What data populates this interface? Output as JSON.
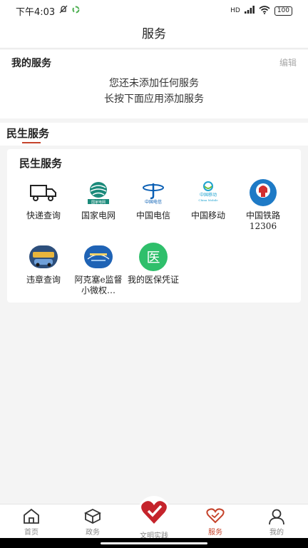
{
  "status_bar": {
    "time": "下午4:03",
    "signal": "HD",
    "battery": "100"
  },
  "nav": {
    "title": "服务"
  },
  "my_services": {
    "title": "我的服务",
    "edit": "编辑",
    "empty_line1": "您还未添加任何服务",
    "empty_line2": "长按下面应用添加服务"
  },
  "section_tab": {
    "label": "民生服务"
  },
  "card": {
    "title": "民生服务",
    "items": [
      {
        "label": "快递查询",
        "icon": "truck-icon"
      },
      {
        "label": "国家电网",
        "icon": "state-grid-icon"
      },
      {
        "label": "中国电信",
        "icon": "china-telecom-icon"
      },
      {
        "label": "中国移动",
        "icon": "china-mobile-icon"
      },
      {
        "label": "中国铁路12306",
        "icon": "china-railway-icon"
      },
      {
        "label": "违章查询",
        "icon": "traffic-violation-icon"
      },
      {
        "label": "阿克塞e监督小微权…",
        "icon": "supervision-icon"
      },
      {
        "label": "我的医保凭证",
        "icon": "medical-insurance-icon",
        "glyph": "医"
      }
    ]
  },
  "tabs": [
    {
      "label": "首页",
      "icon": "home-icon"
    },
    {
      "label": "政务",
      "icon": "box-icon"
    },
    {
      "label": "文明实践",
      "icon": "heart-logo-icon"
    },
    {
      "label": "服务",
      "icon": "heart-icon",
      "active": true
    },
    {
      "label": "我的",
      "icon": "user-icon"
    }
  ],
  "colors": {
    "accent": "#c5432b",
    "background": "#f4f4f4"
  }
}
